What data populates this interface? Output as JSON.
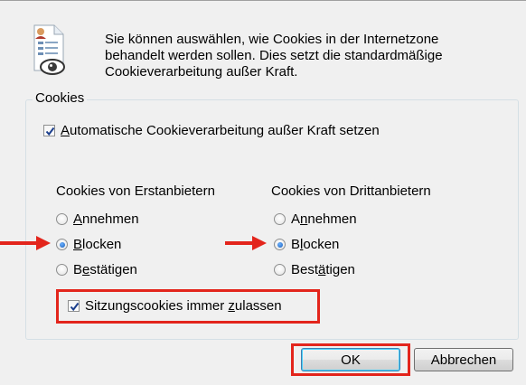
{
  "description": {
    "line1": "Sie können auswählen, wie Cookies in der Internetzone",
    "line2": "behandelt werden sollen. Dies setzt die standardmäßige",
    "line3": "Cookieverarbeitung außer Kraft."
  },
  "cookies_group": {
    "legend": "Cookies",
    "override": {
      "pre": "",
      "accel": "A",
      "post": "utomatische Cookieverarbeitung außer Kraft setzen",
      "checked": true
    },
    "first_party": {
      "heading": "Cookies von Erstanbietern",
      "options": [
        {
          "pre": "",
          "accel": "A",
          "post": "nnehmen",
          "selected": false
        },
        {
          "pre": "",
          "accel": "B",
          "post": "locken",
          "selected": true
        },
        {
          "pre": "B",
          "accel": "e",
          "post": "stätigen",
          "selected": false
        }
      ]
    },
    "third_party": {
      "heading": "Cookies von Drittanbietern",
      "options": [
        {
          "pre": "A",
          "accel": "n",
          "post": "nehmen",
          "selected": false
        },
        {
          "pre": "B",
          "accel": "l",
          "post": "ocken",
          "selected": true
        },
        {
          "pre": "Best",
          "accel": "ä",
          "post": "tigen",
          "selected": false
        }
      ]
    },
    "session": {
      "pre": "Sitzungscookies immer ",
      "accel": "z",
      "post": "ulassen",
      "checked": true
    }
  },
  "buttons": {
    "ok": "OK",
    "cancel": "Abbrechen"
  },
  "colors": {
    "annotation_red": "#e3251c",
    "radio_blue": "#1a5fb8"
  }
}
